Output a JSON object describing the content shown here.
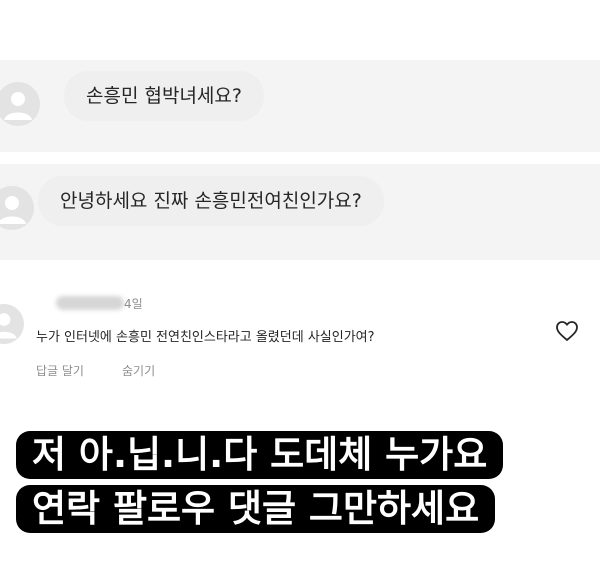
{
  "messages": [
    {
      "text": "손흥민 협박녀세요?"
    },
    {
      "text": "안녕하세요 진짜 손흥민전여친인가요?"
    }
  ],
  "comment": {
    "time": "4일",
    "text": "누가 인터넷에 손흥민 전연친인스타라고 올렸던데 사실인가여?",
    "reply_label": "답글 달기",
    "hide_label": "숨기기"
  },
  "caption": {
    "line1": "저 아.닙.니.다 도데체 누가요",
    "line2": "연락 팔로우 댓글 그만하세요"
  }
}
